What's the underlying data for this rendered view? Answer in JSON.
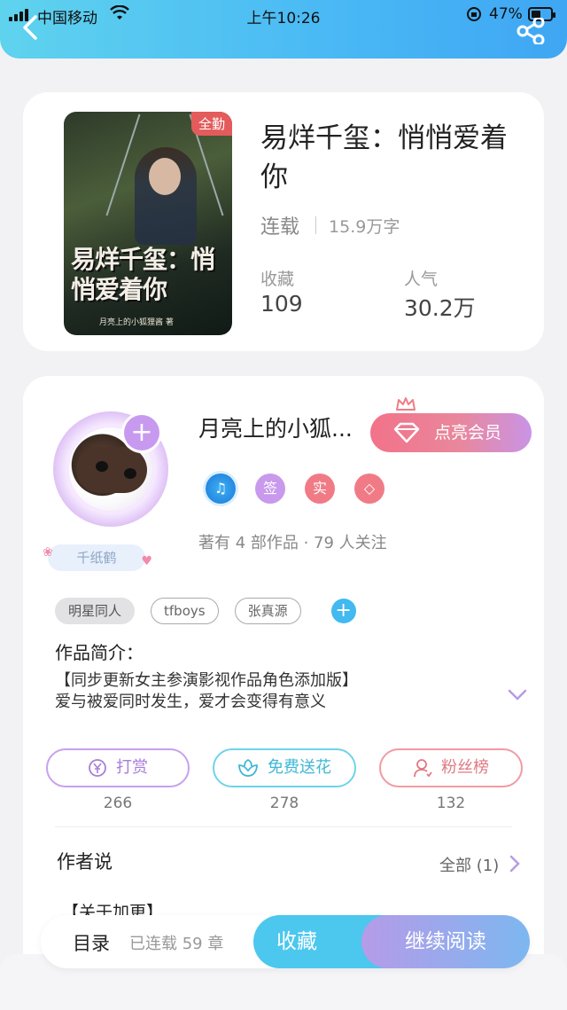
{
  "status_bar": {
    "carrier": "中国移动",
    "time": "上午10:26",
    "battery": "47%"
  },
  "book": {
    "cover_badge": "全勤",
    "cover_title": "易烊千玺：悄悄爱着你",
    "cover_author": "月亮上的小狐狸酱 著",
    "title": "易烊千玺：悄悄爱着你",
    "status": "连载",
    "word_count": "15.9万字",
    "stats": [
      {
        "label": "收藏",
        "value": "109"
      },
      {
        "label": "人气",
        "value": "30.2万"
      }
    ]
  },
  "author": {
    "name": "月亮上的小狐...",
    "title_badge": "千纸鹤",
    "vip_button": "点亮会员",
    "badges": [
      {
        "icon": "music-note-icon",
        "text": "♫"
      },
      {
        "icon": "sign-badge",
        "text": "签"
      },
      {
        "icon": "real-name-badge",
        "text": "实"
      },
      {
        "icon": "diamond-badge",
        "text": "◇"
      }
    ],
    "works_line": "著有 4 部作品 · 79 人关注"
  },
  "tags": [
    "明星同人",
    "tfboys",
    "张真源"
  ],
  "intro": {
    "label": "作品简介：",
    "line1": "【同步更新女主参演影视作品角色添加版】",
    "line2": "爱与被爱同时发生，爱才会变得有意义"
  },
  "actions": [
    {
      "label": "打赏",
      "count": "266"
    },
    {
      "label": "免费送花",
      "count": "278"
    },
    {
      "label": "粉丝榜",
      "count": "132"
    }
  ],
  "author_say": {
    "title": "作者说",
    "all_label": "全部 (1)",
    "preview": "【关于加更】"
  },
  "bottom": {
    "toc": "目录",
    "chapters": "已连载 59 章",
    "collect": "收藏",
    "read": "继续阅读"
  },
  "colors": {
    "header_gradient_start": "#5fd3ee",
    "header_gradient_end": "#3fa6f3",
    "accent_pink": "#f27289",
    "accent_purple": "#c79af0",
    "accent_cyan": "#4cc7ee"
  }
}
